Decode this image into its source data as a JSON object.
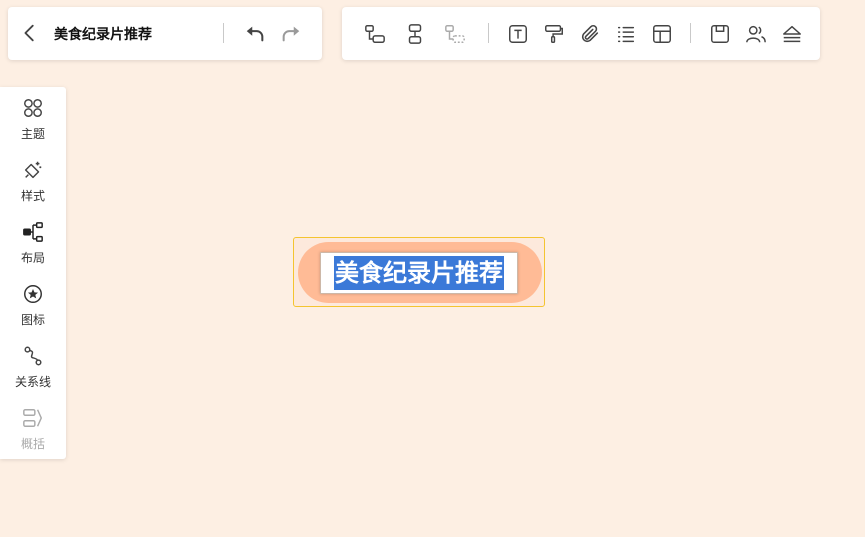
{
  "header": {
    "title": "美食纪录片推荐"
  },
  "sidebar": {
    "items": [
      {
        "label": "主题"
      },
      {
        "label": "样式"
      },
      {
        "label": "布局"
      },
      {
        "label": "图标"
      },
      {
        "label": "关系线"
      },
      {
        "label": "概括",
        "disabled": true
      }
    ]
  },
  "canvas": {
    "root_node_text": "美食纪录片推荐"
  },
  "colors": {
    "canvas_bg": "#fdefe3",
    "node_fill": "#ffbb96",
    "selection_border": "#f4c430",
    "text_highlight": "#3b79d8"
  }
}
